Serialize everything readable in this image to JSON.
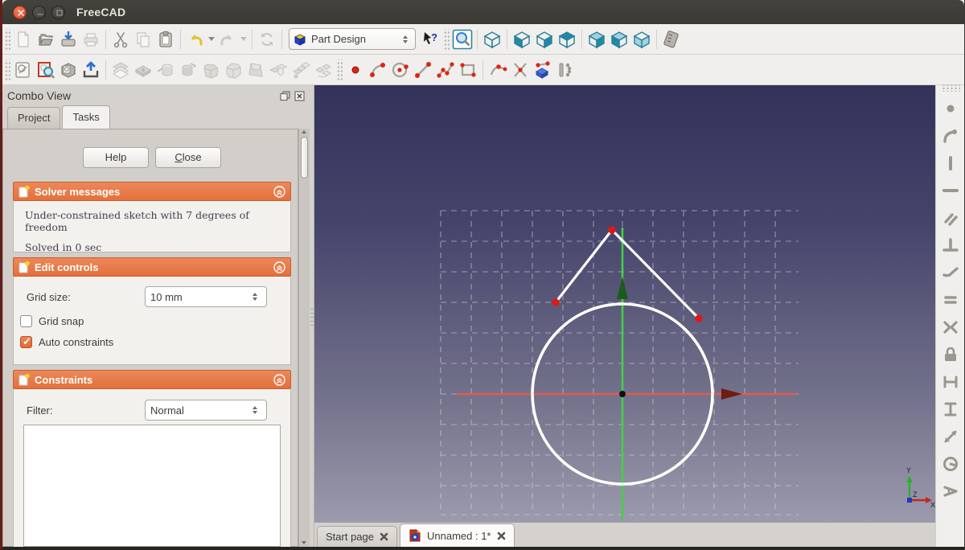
{
  "window": {
    "title": "FreeCAD"
  },
  "titlebar": {
    "buttons": [
      "close",
      "minimize",
      "maximize"
    ]
  },
  "toolbar1": {
    "workbench_selector_value": "Part Design",
    "icons": [
      "new-file",
      "open-file",
      "save",
      "print",
      "cut",
      "copy",
      "paste",
      "undo",
      "redo",
      "refresh",
      "whats-this",
      "fit-all",
      "axonometric-view",
      "view-front",
      "view-right",
      "view-top",
      "view-rear",
      "view-left",
      "view-bottom",
      "measure"
    ]
  },
  "toolbar2": {
    "icons": [
      "new-sketch",
      "edit-sketch",
      "map-sketch",
      "leave-sketch",
      "pad",
      "pocket",
      "revolution",
      "groove",
      "fillet",
      "chamfer",
      "draft",
      "mirrored",
      "linear-pattern",
      "polar-pattern",
      "point",
      "arc",
      "circle",
      "line",
      "polyline",
      "rectangle",
      "sketch-fillet",
      "trim",
      "external-geometry",
      "construction-mode"
    ]
  },
  "right_toolbar": {
    "icons": [
      "coincident",
      "point-on-object",
      "vertical",
      "horizontal",
      "parallel",
      "perpendicular",
      "tangent",
      "equal",
      "symmetric",
      "lock",
      "horizontal-distance",
      "vertical-distance",
      "distance",
      "radius",
      "internal-angle"
    ]
  },
  "combo_view": {
    "title": "Combo View",
    "tabs": {
      "project": "Project",
      "tasks": "Tasks"
    },
    "buttons": {
      "help": "Help",
      "close": "Close"
    },
    "solver": {
      "title": "Solver messages",
      "messages": [
        "Under-constrained sketch with 7 degrees of freedom",
        "Solved in 0 sec"
      ]
    },
    "edit_controls": {
      "title": "Edit controls",
      "grid_size_label": "Grid size:",
      "grid_size_value": "10 mm",
      "grid_snap": {
        "label": "Grid snap",
        "checked": false
      },
      "auto_constraints": {
        "label": "Auto constraints",
        "checked": true
      }
    },
    "constraints": {
      "title": "Constraints",
      "filter_label": "Filter:",
      "filter_value": "Normal",
      "list_items": []
    }
  },
  "viewport": {
    "document_tabs": [
      {
        "label": "Start page",
        "active": false
      },
      {
        "label": "Unnamed : 1*",
        "active": true
      }
    ],
    "triad": {
      "x": "X",
      "y": "Y",
      "z": "Z"
    },
    "colors": {
      "bg_top": "#33325a",
      "bg_bottom": "#9c9aad",
      "grid": "#dcdce4",
      "sketch_edge": "#ffffff",
      "vertex": "#e41810",
      "y_axis": "#44cf44",
      "x_axis": "#e25a4e",
      "origin": "#0c0c1e",
      "section_header": "#e87c4d",
      "checkbox_checked": "#e87c4d",
      "close_button": "#dc4632"
    }
  }
}
